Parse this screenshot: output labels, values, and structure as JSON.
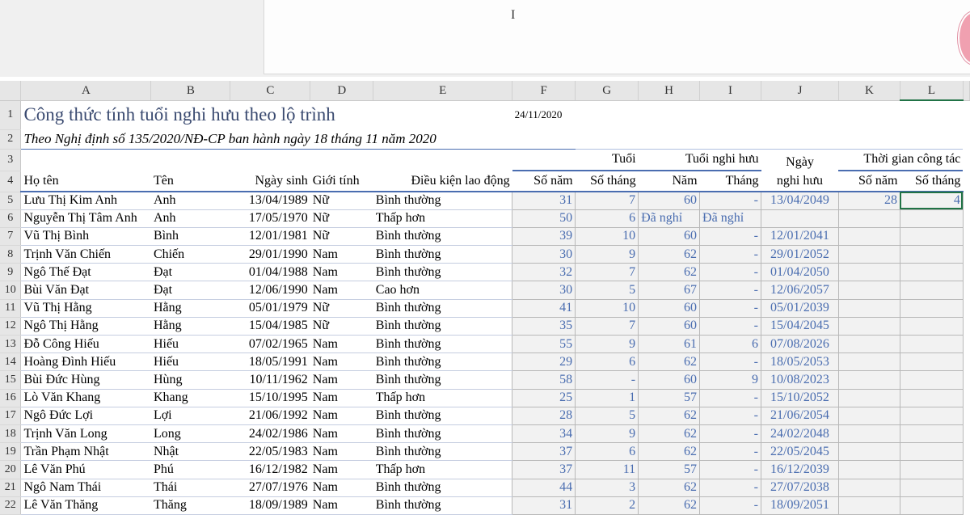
{
  "columns": [
    "A",
    "B",
    "C",
    "D",
    "E",
    "F",
    "G",
    "H",
    "I",
    "J",
    "K",
    "L"
  ],
  "title": "Công thức tính tuổi nghi hưu theo lộ trình",
  "subtitle": "Theo Nghị định số 135/2020/NĐ-CP ban hành ngày 18 tháng 11 năm 2020",
  "current_date": "24/11/2020",
  "headers": {
    "ho_ten": "Họ tên",
    "ten": "Tên",
    "ngay_sinh": "Ngày sinh",
    "gioi_tinh": "Giới tính",
    "dieu_kien": "Điều kiện lao động",
    "tuoi": "Tuổi",
    "tuoi_nghi_huu": "Tuổi nghi hưu",
    "ngay": "Ngày",
    "nghi_huu": "nghi hưu",
    "thoi_gian": "Thời gian công tác",
    "so_nam": "Số năm",
    "so_thang": "Số tháng",
    "nam": "Năm",
    "thang": "Tháng"
  },
  "rows": [
    [
      "Lưu Thị Kim Anh",
      "Anh",
      "13/04/1989",
      "Nữ",
      "Bình thường",
      "31",
      "7",
      "60",
      "-",
      "13/04/2049",
      "28",
      "4"
    ],
    [
      "Nguyễn Thị Tâm Anh",
      "Anh",
      "17/05/1970",
      "Nữ",
      "Thấp hơn",
      "50",
      "6",
      "Đã nghỉ",
      "Đã nghỉ",
      "",
      "",
      ""
    ],
    [
      "Vũ Thị Bình",
      "Bình",
      "12/01/1981",
      "Nữ",
      "Bình thường",
      "39",
      "10",
      "60",
      "-",
      "12/01/2041",
      "",
      ""
    ],
    [
      "Trịnh Văn Chiến",
      "Chiến",
      "29/01/1990",
      "Nam",
      "Bình thường",
      "30",
      "9",
      "62",
      "-",
      "29/01/2052",
      "",
      ""
    ],
    [
      "Ngô Thế Đạt",
      "Đạt",
      "01/04/1988",
      "Nam",
      "Bình thường",
      "32",
      "7",
      "62",
      "-",
      "01/04/2050",
      "",
      ""
    ],
    [
      "Bùi Văn Đạt",
      "Đạt",
      "12/06/1990",
      "Nam",
      "Cao hơn",
      "30",
      "5",
      "67",
      "-",
      "12/06/2057",
      "",
      ""
    ],
    [
      "Vũ Thị Hằng",
      "Hằng",
      "05/01/1979",
      "Nữ",
      "Bình thường",
      "41",
      "10",
      "60",
      "-",
      "05/01/2039",
      "",
      ""
    ],
    [
      "Ngô Thị Hằng",
      "Hằng",
      "15/04/1985",
      "Nữ",
      "Bình thường",
      "35",
      "7",
      "60",
      "-",
      "15/04/2045",
      "",
      ""
    ],
    [
      "Đỗ Công Hiếu",
      "Hiếu",
      "07/02/1965",
      "Nam",
      "Bình thường",
      "55",
      "9",
      "61",
      "6",
      "07/08/2026",
      "",
      ""
    ],
    [
      "Hoàng Đình Hiếu",
      "Hiếu",
      "18/05/1991",
      "Nam",
      "Bình thường",
      "29",
      "6",
      "62",
      "-",
      "18/05/2053",
      "",
      ""
    ],
    [
      "Bùi Đức Hùng",
      "Hùng",
      "10/11/1962",
      "Nam",
      "Bình thường",
      "58",
      "-",
      "60",
      "9",
      "10/08/2023",
      "",
      ""
    ],
    [
      "Lò Văn Khang",
      "Khang",
      "15/10/1995",
      "Nam",
      "Thấp hơn",
      "25",
      "1",
      "57",
      "-",
      "15/10/2052",
      "",
      ""
    ],
    [
      "Ngô Đức Lợi",
      "Lợi",
      "21/06/1992",
      "Nam",
      "Bình thường",
      "28",
      "5",
      "62",
      "-",
      "21/06/2054",
      "",
      ""
    ],
    [
      "Trịnh Văn Long",
      "Long",
      "24/02/1986",
      "Nam",
      "Bình thường",
      "34",
      "9",
      "62",
      "-",
      "24/02/2048",
      "",
      ""
    ],
    [
      "Trần Phạm Nhật",
      "Nhật",
      "22/05/1983",
      "Nam",
      "Bình thường",
      "37",
      "6",
      "62",
      "-",
      "22/05/2045",
      "",
      ""
    ],
    [
      "Lê Văn Phú",
      "Phú",
      "16/12/1982",
      "Nam",
      "Thấp hơn",
      "37",
      "11",
      "57",
      "-",
      "16/12/2039",
      "",
      ""
    ],
    [
      "Ngô Nam Thái",
      "Thái",
      "27/07/1976",
      "Nam",
      "Bình thường",
      "44",
      "3",
      "62",
      "-",
      "27/07/2038",
      "",
      ""
    ],
    [
      "Lê Văn Thăng",
      "Thăng",
      "18/09/1989",
      "Nam",
      "Bình thường",
      "31",
      "2",
      "62",
      "-",
      "18/09/2051",
      "",
      ""
    ]
  ]
}
